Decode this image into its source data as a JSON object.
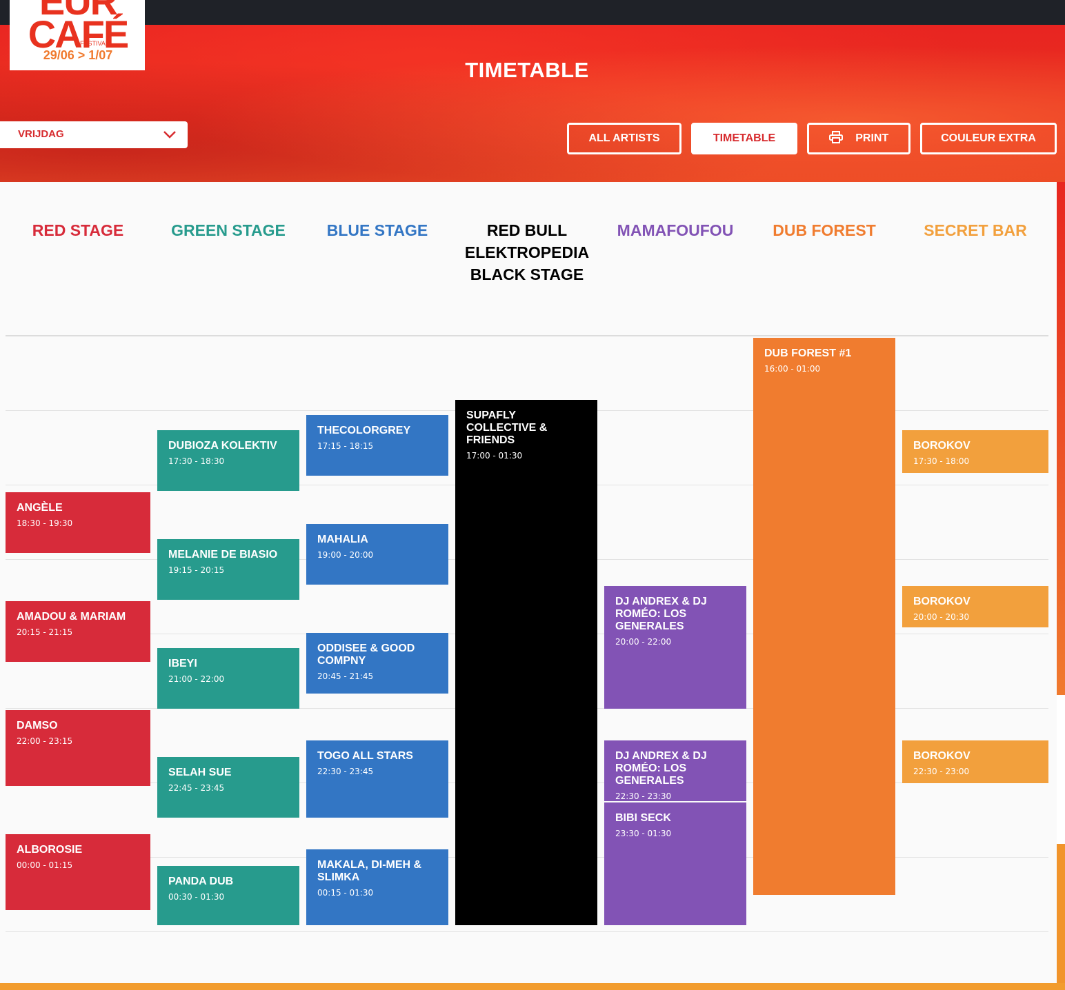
{
  "logo": {
    "line1": "EUR",
    "line2": "CAFÉ",
    "festival": "FESTIVAL",
    "dates": "29/06 > 1/07"
  },
  "page_title": "TIMETABLE",
  "day_select": {
    "value": "VRIJDAG"
  },
  "nav_buttons": {
    "all_artists": "ALL ARTISTS",
    "timetable": "TIMETABLE",
    "print": "PRINT",
    "couleur_extra": "COULEUR EXTRA"
  },
  "stages": [
    {
      "name": "RED STAGE",
      "color": "#d72b3a"
    },
    {
      "name": "GREEN STAGE",
      "color": "#279b8d"
    },
    {
      "name": "BLUE STAGE",
      "color": "#3376c4"
    },
    {
      "name": "RED BULL ELEKTROPEDIA BLACK STAGE",
      "color": "#000000"
    },
    {
      "name": "MAMAFOUFOU",
      "color": "#8253b5"
    },
    {
      "name": "DUB FOREST",
      "color": "#f07c2f"
    },
    {
      "name": "SECRET BAR",
      "color": "#f2a03d"
    }
  ],
  "schedule": {
    "red": [
      {
        "name": "ANGÈLE",
        "time": "18:30 - 19:30"
      },
      {
        "name": "AMADOU & MARIAM",
        "time": "20:15 - 21:15"
      },
      {
        "name": "DAMSO",
        "time": "22:00 - 23:15"
      },
      {
        "name": "ALBOROSIE",
        "time": "00:00 - 01:15"
      }
    ],
    "green": [
      {
        "name": "DUBIOZA KOLEKTIV",
        "time": "17:30 - 18:30"
      },
      {
        "name": "MELANIE DE BIASIO",
        "time": "19:15 - 20:15"
      },
      {
        "name": "IBEYI",
        "time": "21:00 - 22:00"
      },
      {
        "name": "SELAH SUE",
        "time": "22:45 - 23:45"
      },
      {
        "name": "PANDA DUB",
        "time": "00:30 - 01:30"
      }
    ],
    "blue": [
      {
        "name": "THECOLORGREY",
        "time": "17:15 - 18:15"
      },
      {
        "name": "MAHALIA",
        "time": "19:00 - 20:00"
      },
      {
        "name": "ODDISEE & GOOD COMPNY",
        "time": "20:45 - 21:45"
      },
      {
        "name": "TOGO ALL STARS",
        "time": "22:30 - 23:45"
      },
      {
        "name": "MAKALA, DI-MEH & SLIMKA",
        "time": "00:15 - 01:30"
      }
    ],
    "black": [
      {
        "name": "SUPAFLY COLLECTIVE & FRIENDS",
        "time": "17:00 - 01:30"
      }
    ],
    "purple": [
      {
        "name": "DJ ANDREX & DJ ROMÉO: LOS GENERALES",
        "time": "20:00 - 22:00"
      },
      {
        "name": "DJ ANDREX & DJ ROMÉO: LOS GENERALES",
        "time": "22:30 - 23:30"
      },
      {
        "name": "BIBI SECK",
        "time": "23:30 - 01:30"
      }
    ],
    "orange": [
      {
        "name": "DUB FOREST #1",
        "time": "16:00 - 01:00"
      }
    ],
    "yellow": [
      {
        "name": "BOROKOV",
        "time": "17:30 - 18:00"
      },
      {
        "name": "BOROKOV",
        "time": "20:00 - 20:30"
      },
      {
        "name": "BOROKOV",
        "time": "22:30 - 23:00"
      }
    ]
  }
}
